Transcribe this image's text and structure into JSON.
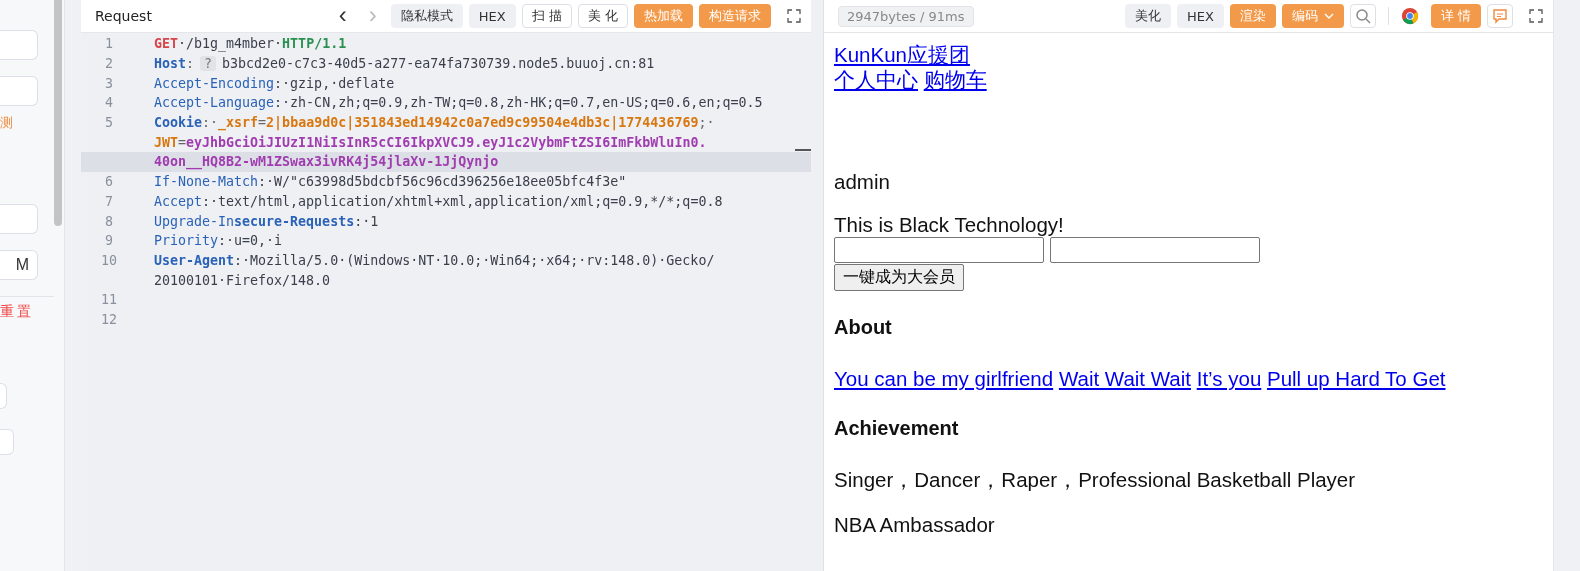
{
  "sidebar": {
    "fields": [
      {
        "kind": "input"
      },
      {
        "kind": "input"
      }
    ],
    "link": "测",
    "fields2": [
      {
        "kind": "input"
      },
      {
        "kind": "input",
        "value": "M"
      }
    ],
    "reset": "重置"
  },
  "request": {
    "title": "Request",
    "nav": [
      {
        "glyph": "‹",
        "disabled": false
      },
      {
        "glyph": "›",
        "disabled": true
      }
    ],
    "buttons": [
      {
        "label": "隐私模式",
        "kind": "gray"
      },
      {
        "label": "HEX",
        "kind": "gray"
      },
      {
        "label": "扫 描",
        "kind": "outline"
      },
      {
        "label": "美 化",
        "kind": "outline"
      },
      {
        "label": "热加载",
        "kind": "orange"
      },
      {
        "label": "构造请求",
        "kind": "orange"
      }
    ],
    "lines": [
      {
        "number": "1",
        "rows": [
          {
            "segments": [
              {
                "text": "GET",
                "kind": "method"
              },
              {
                "text": "·/b1g_m4mber·",
                "kind": "plain"
              },
              {
                "text": "HTTP/1.1",
                "kind": "proto"
              }
            ]
          }
        ]
      },
      {
        "number": "2",
        "rows": [
          {
            "segments": [
              {
                "text": "Host",
                "kind": "keybold"
              },
              {
                "text": ":",
                "kind": "punct"
              },
              {
                "text": "?",
                "kind": "badge"
              },
              {
                "text": "b3bcd2e0-c7c3-40d5-a277-ea74fa730739.node5.buuoj.cn:81",
                "kind": "plain"
              }
            ]
          }
        ]
      },
      {
        "number": "3",
        "rows": [
          {
            "segments": [
              {
                "text": "Accept-Encoding",
                "kind": "key"
              },
              {
                "text": ":·gzip,·deflate",
                "kind": "plain"
              }
            ]
          }
        ]
      },
      {
        "number": "4",
        "rows": [
          {
            "segments": [
              {
                "text": "Accept-Language",
                "kind": "key"
              },
              {
                "text": ":·zh-CN,zh;q=0.9,zh-TW;q=0.8,zh-HK;q=0.7,en-US;q=0.6,en;q=0.5",
                "kind": "plain"
              }
            ]
          }
        ]
      },
      {
        "number": "5",
        "rows": [
          {
            "segments": [
              {
                "text": "Cookie",
                "kind": "keybold"
              },
              {
                "text": ":·",
                "kind": "punct"
              },
              {
                "text": "_xsrf",
                "kind": "ckey"
              },
              {
                "text": "=",
                "kind": "punct"
              },
              {
                "text": "2|bbaa9d0c|351843ed14942c0a7ed9c99504e4db3c|1774436769",
                "kind": "cval"
              },
              {
                "text": ";·",
                "kind": "punct"
              }
            ]
          },
          {
            "segments": [
              {
                "text": "JWT",
                "kind": "ckey"
              },
              {
                "text": "=",
                "kind": "punct"
              },
              {
                "text": "eyJhbGciOiJIUzI1NiIsInR5cCI6IkpXVCJ9.eyJ1c2VybmFtZSI6ImFkbWluIn0.",
                "kind": "jwt"
              }
            ]
          },
          {
            "segments": [
              {
                "text": "40on__HQ8B2-wM1ZSwax3ivRK4j54jlaXv-1JjQynjo",
                "kind": "jwt"
              }
            ],
            "highlighted": true
          }
        ]
      },
      {
        "number": "6",
        "rows": [
          {
            "segments": [
              {
                "text": "If-None-Match",
                "kind": "key"
              },
              {
                "text": ":·W/\"c63998d5bdcbf56c96cd396256e18ee05bfc4f3e\"",
                "kind": "plain"
              }
            ]
          }
        ]
      },
      {
        "number": "7",
        "rows": [
          {
            "segments": [
              {
                "text": "Accept",
                "kind": "key"
              },
              {
                "text": ":·text/html,application/xhtml+xml,application/xml;q=0.9,*/*;q=0.8",
                "kind": "plain"
              }
            ]
          }
        ]
      },
      {
        "number": "8",
        "rows": [
          {
            "segments": [
              {
                "text": "Upgrade-In",
                "kind": "key"
              },
              {
                "text": "secure-Requests",
                "kind": "keybold"
              },
              {
                "text": ":·1",
                "kind": "plain"
              }
            ]
          }
        ]
      },
      {
        "number": "9",
        "rows": [
          {
            "segments": [
              {
                "text": "Priority",
                "kind": "key"
              },
              {
                "text": ":·u=0,·i",
                "kind": "plain"
              }
            ]
          }
        ]
      },
      {
        "number": "10",
        "rows": [
          {
            "segments": [
              {
                "text": "User-Agent",
                "kind": "keybold"
              },
              {
                "text": ":·Mozilla/5.0·(Windows·NT·10.0;·Win64;·x64;·rv:148.0)·Gecko/",
                "kind": "plain"
              }
            ]
          },
          {
            "segments": [
              {
                "text": "20100101·Firefox/148.0",
                "kind": "plain"
              }
            ]
          }
        ]
      },
      {
        "number": "11"
      },
      {
        "number": "12"
      }
    ]
  },
  "response": {
    "stats": "2947bytes / 91ms",
    "buttons": [
      {
        "label": "美化",
        "kind": "gray"
      },
      {
        "label": "HEX",
        "kind": "gray"
      },
      {
        "label": "渲染",
        "kind": "orange"
      },
      {
        "label": "编码",
        "kind": "dropdown"
      },
      {
        "kind": "search"
      },
      {
        "kind": "browser"
      },
      {
        "label": "详 情",
        "kind": "orange"
      },
      {
        "kind": "comment"
      }
    ],
    "page": {
      "brand": "KunKun应援团",
      "nav": [
        "个人中心",
        "购物车"
      ],
      "user": "admin",
      "tagline": "This is Black Technology!",
      "inputs": [
        {
          "kind": "text"
        },
        {
          "kind": "text"
        }
      ],
      "submit": "一键成为大会员",
      "about_title": "About",
      "about_links": [
        "You can be my girlfriend",
        "Wait Wait Wait",
        "It’s you",
        "Pull up Hard To Get"
      ],
      "achievement_title": "Achievement",
      "achievements": [
        "Singer，Dancer，Raper，Professional Basketball Player",
        "NBA Ambassador"
      ]
    }
  }
}
